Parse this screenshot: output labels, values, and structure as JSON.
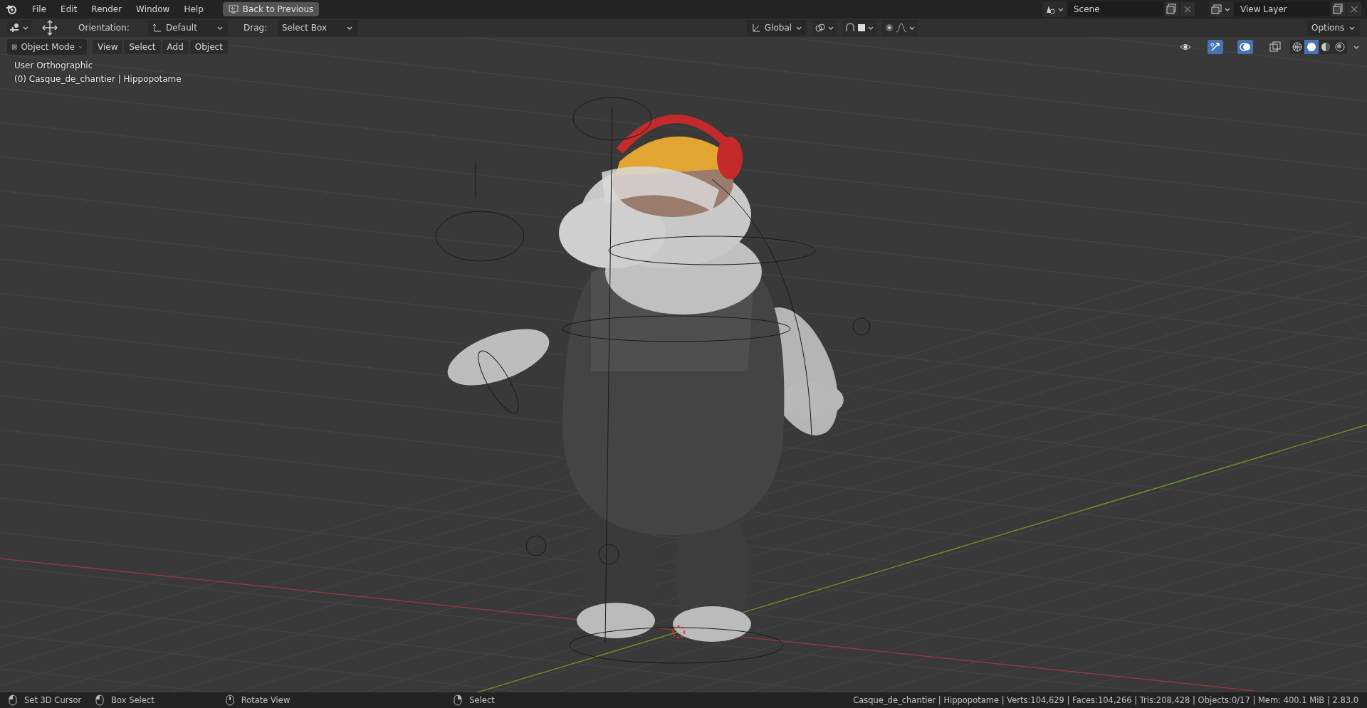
{
  "menu_bar": {
    "menus": [
      {
        "label": "File"
      },
      {
        "label": "Edit"
      },
      {
        "label": "Render"
      },
      {
        "label": "Window"
      },
      {
        "label": "Help"
      }
    ],
    "back_button": "Back to Previous",
    "scene": "Scene",
    "view_layer": "View Layer"
  },
  "tool_header": {
    "orientation_label": "Orientation:",
    "orientation_value": "Default",
    "drag_label": "Drag:",
    "drag_value": "Select Box",
    "transform_orientation": "Global",
    "options": "Options"
  },
  "viewport_header": {
    "mode": "Object Mode",
    "menus": [
      {
        "label": "View"
      },
      {
        "label": "Select"
      },
      {
        "label": "Add"
      },
      {
        "label": "Object"
      }
    ],
    "toggles": [
      {
        "kind": "visibility",
        "on": false
      },
      {
        "kind": "gizmo",
        "on": true
      },
      {
        "kind": "overlay",
        "on": true
      },
      {
        "kind": "xray",
        "on": false
      }
    ],
    "shading": [
      {
        "kind": "wireframe",
        "selected": false
      },
      {
        "kind": "solid",
        "selected": true
      },
      {
        "kind": "material",
        "selected": false
      },
      {
        "kind": "rendered",
        "selected": false
      }
    ]
  },
  "viewport_overlay": {
    "view_name": "User Orthographic",
    "object_info": "(0) Casque_de_chantier | Hippopotame"
  },
  "status_bar": {
    "hints": [
      {
        "kind": "left",
        "label": "Set 3D Cursor"
      },
      {
        "kind": "drag",
        "label": "Box Select"
      },
      {
        "kind": "middle",
        "label": "Rotate View"
      },
      {
        "kind": "right",
        "label": "Select"
      }
    ],
    "stats": "Casque_de_chantier | Hippopotame | Verts:104,629 | Faces:104,266 | Tris:208,428 | Objects:0/17 | Mem: 400.1 MiB | 2.83.0"
  }
}
